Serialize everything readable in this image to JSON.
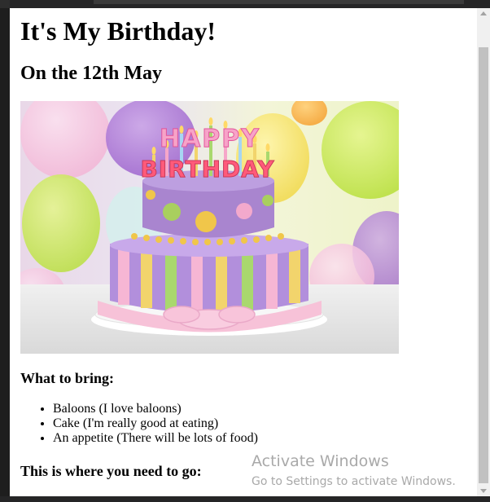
{
  "page": {
    "heading": "It's My Birthday!",
    "subheading": "On the 12th May",
    "image": {
      "cake_text_top": "HAPPY",
      "cake_text_bottom": "BIRTHDAY"
    },
    "bring_heading": "What to bring:",
    "bring_items": [
      "Baloons (I love baloons)",
      "Cake (I'm really good at eating)",
      "An appetite (There will be lots of food)"
    ],
    "go_heading": "This is where you need to go:"
  },
  "watermark": {
    "title": "Activate Windows",
    "subtitle": "Go to Settings to activate Windows."
  },
  "colors": {
    "page_background": "#ffffff",
    "editor_chrome": "#1e1e1e",
    "scrollbar_thumb": "#c1c1c1"
  }
}
